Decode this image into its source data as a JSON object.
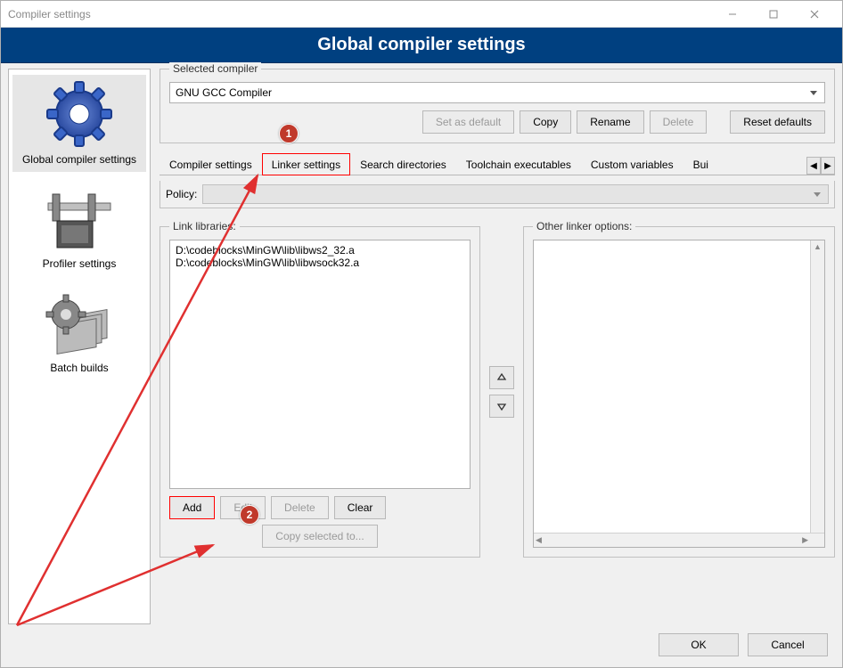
{
  "window": {
    "title": "Compiler settings"
  },
  "banner": {
    "title": "Global compiler settings"
  },
  "sidebar": {
    "items": [
      {
        "label": "Global compiler settings"
      },
      {
        "label": "Profiler settings"
      },
      {
        "label": "Batch builds"
      }
    ]
  },
  "selected_compiler": {
    "legend": "Selected compiler",
    "value": "GNU GCC Compiler",
    "buttons": {
      "set_default": "Set as default",
      "copy": "Copy",
      "rename": "Rename",
      "delete": "Delete",
      "reset": "Reset defaults"
    }
  },
  "tabs": {
    "items": [
      {
        "label": "Compiler settings"
      },
      {
        "label": "Linker settings"
      },
      {
        "label": "Search directories"
      },
      {
        "label": "Toolchain executables"
      },
      {
        "label": "Custom variables"
      },
      {
        "label": "Bui"
      }
    ],
    "active_index": 1
  },
  "policy": {
    "label": "Policy:"
  },
  "link_libraries": {
    "legend": "Link libraries:",
    "items": [
      "D:\\codeblocks\\MinGW\\lib\\libws2_32.a",
      "D:\\codeblocks\\MinGW\\lib\\libwsock32.a"
    ],
    "buttons": {
      "add": "Add",
      "edit": "Edit",
      "delete": "Delete",
      "clear": "Clear",
      "copy": "Copy selected to..."
    }
  },
  "other_linker": {
    "legend": "Other linker options:"
  },
  "footer": {
    "ok": "OK",
    "cancel": "Cancel"
  },
  "annotations": {
    "badge1": "1",
    "badge2": "2"
  }
}
